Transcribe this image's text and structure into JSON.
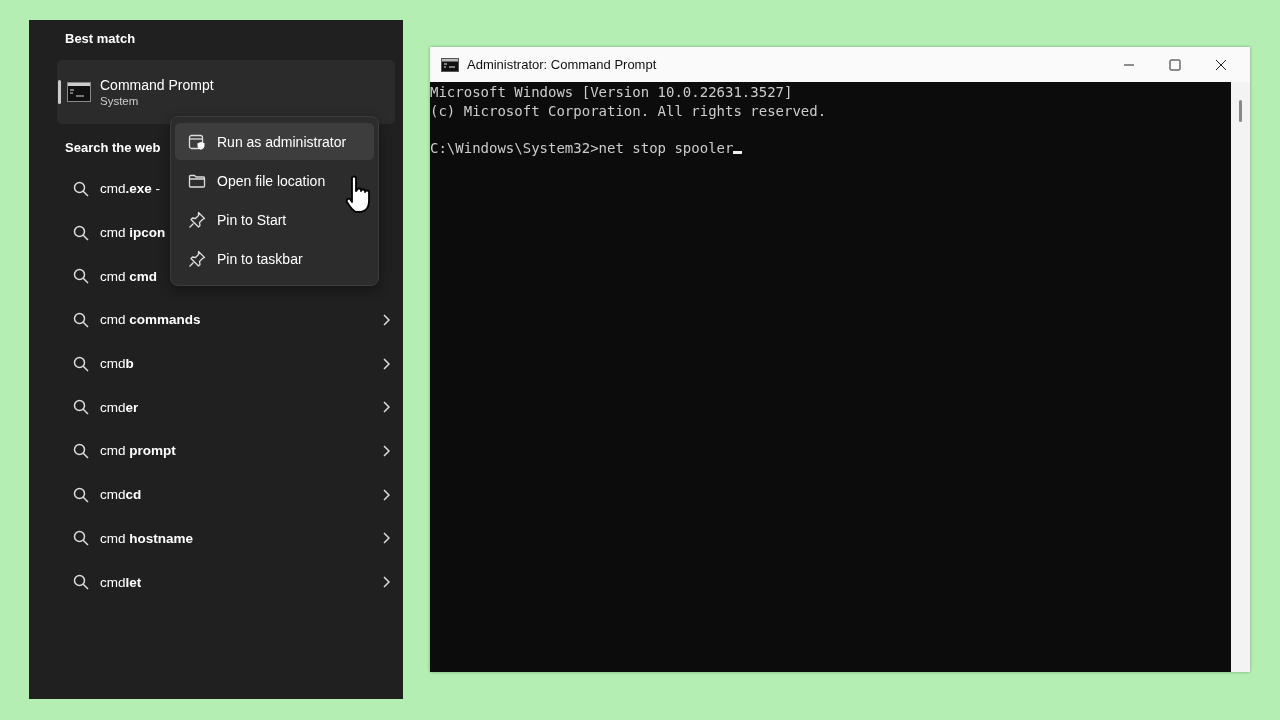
{
  "start_panel": {
    "best_match_heading": "Best match",
    "best_match": {
      "name": "Command Prompt",
      "type": "System",
      "selected": true
    },
    "web_heading": "Search the web",
    "web_results": [
      {
        "text": "cmd**.exe** -",
        "chevron": false
      },
      {
        "text": "cmd **ipcon**",
        "chevron": false
      },
      {
        "text": "cmd **cmd**",
        "chevron": false
      },
      {
        "text": "cmd **commands**",
        "chevron": true
      },
      {
        "text": "cmd**b**",
        "chevron": true
      },
      {
        "text": "cmd**er**",
        "chevron": true
      },
      {
        "text": "cmd **prompt**",
        "chevron": true
      },
      {
        "text": "cmd**cd**",
        "chevron": true
      },
      {
        "text": "cmd **hostname**",
        "chevron": true
      },
      {
        "text": "cmd**let**",
        "chevron": true
      }
    ]
  },
  "context_menu": {
    "items": [
      {
        "kind": "run-admin",
        "label": "Run as administrator",
        "selected": true
      },
      {
        "kind": "folder",
        "label": "Open file location",
        "selected": false
      },
      {
        "kind": "pin",
        "label": "Pin to Start",
        "selected": false
      },
      {
        "kind": "pin",
        "label": "Pin to taskbar",
        "selected": false
      }
    ]
  },
  "console_window": {
    "title": "Administrator: Command Prompt",
    "header_lines": [
      "Microsoft Windows [Version 10.0.22631.3527]",
      "(c) Microsoft Corporation. All rights reserved."
    ],
    "prompt": "C:\\Windows\\System32>net stop spooler",
    "cursor_visible": true
  }
}
